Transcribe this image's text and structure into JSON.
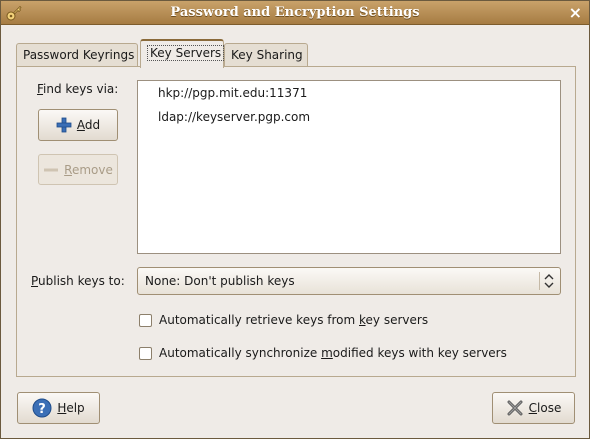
{
  "window": {
    "title": "Password and Encryption Settings",
    "close_glyph": "×"
  },
  "tabs": [
    {
      "label": "Password Keyrings"
    },
    {
      "label": "Key Servers"
    },
    {
      "label": "Key Sharing"
    }
  ],
  "find_keys": {
    "label_mnemonic": "F",
    "label_rest": "ind keys via:"
  },
  "buttons": {
    "add": {
      "mnemonic": "A",
      "rest": "dd",
      "icon": "plus-icon"
    },
    "remove": {
      "mnemonic": "R",
      "rest": "emove",
      "icon": "minus-icon"
    },
    "help": {
      "mnemonic": "H",
      "rest": "elp",
      "icon": "help-icon"
    },
    "close": {
      "mnemonic": "C",
      "rest": "lose",
      "icon": "close-icon"
    }
  },
  "key_servers": [
    "hkp://pgp.mit.edu:11371",
    "ldap://keyserver.pgp.com"
  ],
  "publish": {
    "label_mnemonic": "P",
    "label_rest": "ublish keys to:",
    "selected": "None: Don't publish keys"
  },
  "options": {
    "retrieve": {
      "before": "Automatically retrieve keys from ",
      "mnemonic": "k",
      "after": "ey servers",
      "checked": false
    },
    "sync": {
      "before": "Automatically synchronize ",
      "mnemonic": "m",
      "after": "odified keys with key servers",
      "checked": false
    }
  },
  "colors": {
    "titlebar": "#b58d55",
    "window_bg": "#efebe7",
    "accent_blue": "#3b6fb6"
  }
}
